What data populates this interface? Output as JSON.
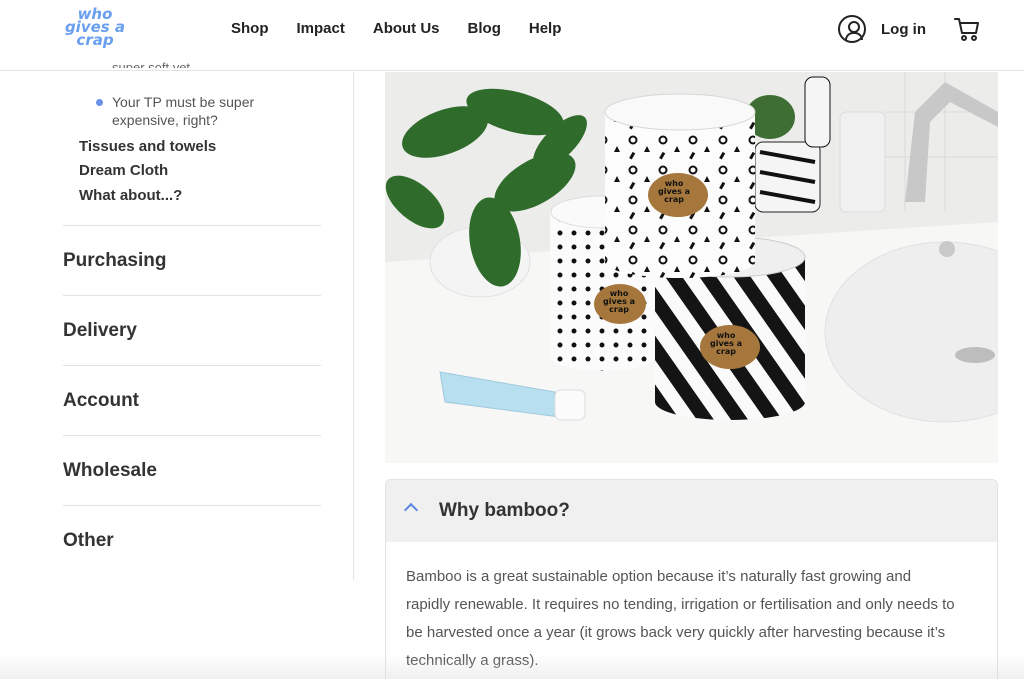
{
  "header": {
    "logo": {
      "line1": "who",
      "line2": "gives a",
      "line3": "crap"
    },
    "nav": [
      "Shop",
      "Impact",
      "About Us",
      "Blog",
      "Help"
    ],
    "login_label": "Log in"
  },
  "sidebar": {
    "cut_text": "super soft yet...",
    "bullet_text": "Your TP must be super expensive, right?",
    "sub_links": [
      "Tissues and towels",
      "Dream Cloth",
      "What about...?"
    ],
    "sections": [
      "Purchasing",
      "Delivery",
      "Account",
      "Wholesale",
      "Other"
    ]
  },
  "accordion": {
    "title": "Why bamboo?",
    "body": "Bamboo is a great sustainable option because it’s naturally fast growing and rapidly renewable. It requires no tending, irrigation or fertilisation and only needs to be harvested once a year (it grows back very quickly after harvesting because it’s technically a grass)."
  },
  "colors": {
    "accent": "#6a9ff0",
    "chevron": "#5b87e0",
    "text": "#333333"
  },
  "product_label": {
    "line1": "who",
    "line2": "gives a",
    "line3": "crap"
  }
}
